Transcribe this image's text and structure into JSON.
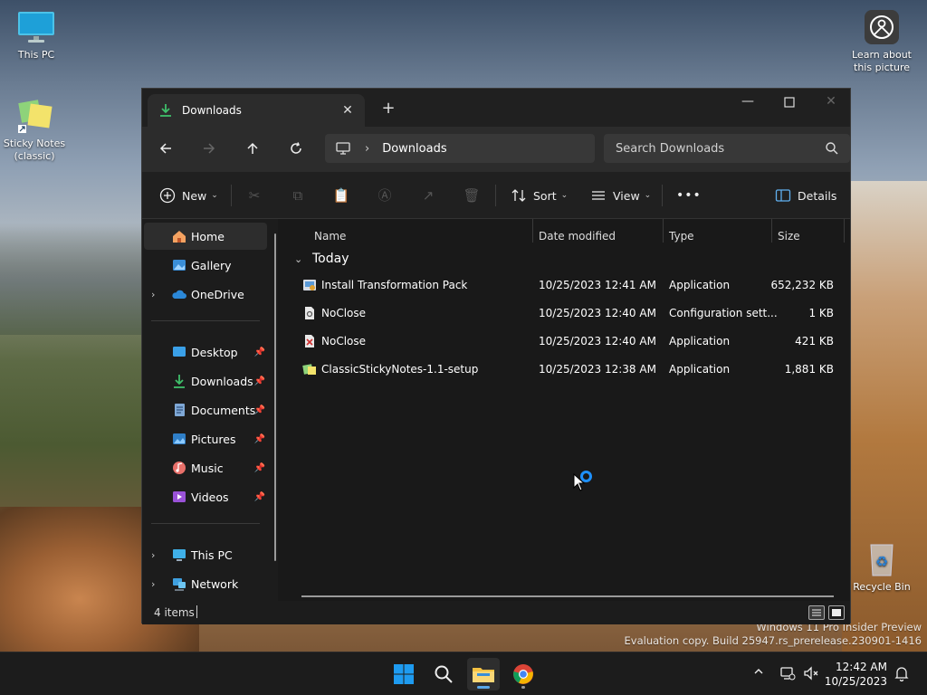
{
  "desktop": {
    "icons": [
      {
        "label": "This PC"
      },
      {
        "label": "Sticky Notes (classic)"
      },
      {
        "label": "Learn about this picture"
      },
      {
        "label": "Recycle Bin"
      }
    ],
    "watermark": {
      "line1": "Windows 11 Pro Insider Preview",
      "line2": "Evaluation copy. Build 25947.rs_prerelease.230901-1416"
    }
  },
  "window": {
    "tab_title": "Downloads",
    "new_tab": "+",
    "address": {
      "path": "Downloads"
    },
    "search": {
      "placeholder": "Search Downloads"
    },
    "commands": {
      "new": "New",
      "sort": "Sort",
      "view": "View",
      "more": "•••",
      "details": "Details"
    },
    "nav": {
      "items": [
        {
          "label": "Home",
          "selected": true
        },
        {
          "label": "Gallery"
        },
        {
          "label": "OneDrive"
        },
        {
          "label": "Desktop",
          "pinned": true
        },
        {
          "label": "Downloads",
          "pinned": true
        },
        {
          "label": "Documents",
          "pinned": true
        },
        {
          "label": "Pictures",
          "pinned": true
        },
        {
          "label": "Music",
          "pinned": true
        },
        {
          "label": "Videos",
          "pinned": true
        },
        {
          "label": "This PC"
        },
        {
          "label": "Network"
        }
      ]
    },
    "columns": {
      "name": "Name",
      "date": "Date modified",
      "type": "Type",
      "size": "Size"
    },
    "group": "Today",
    "files": [
      {
        "name": "Install Transformation Pack",
        "date": "10/25/2023 12:41 AM",
        "type": "Application",
        "size": "652,232 KB"
      },
      {
        "name": "NoClose",
        "date": "10/25/2023 12:40 AM",
        "type": "Configuration sett...",
        "size": "1 KB"
      },
      {
        "name": "NoClose",
        "date": "10/25/2023 12:40 AM",
        "type": "Application",
        "size": "421 KB"
      },
      {
        "name": "ClassicStickyNotes-1.1-setup",
        "date": "10/25/2023 12:38 AM",
        "type": "Application",
        "size": "1,881 KB"
      }
    ],
    "status": {
      "count": "4 items"
    }
  },
  "taskbar": {
    "clock": {
      "time": "12:42 AM",
      "date": "10/25/2023"
    }
  },
  "colors": {
    "accent": "#1e90ff",
    "window_bg": "#191919",
    "taskbar_bg": "#1c1c1c"
  }
}
